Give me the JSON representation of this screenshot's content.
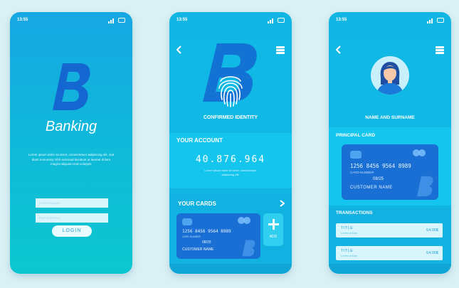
{
  "status": {
    "time": "13:55"
  },
  "login": {
    "brand": "Banking",
    "description": "Lorem ipsum dolor sit amet, consectetuer adipiscing elit, sed diam nonummy nibh euismod tincidunt ut laoreet dolore magna aliquam erat volutpat.",
    "username_placeholder": "USERNAME",
    "password_placeholder": "PASSWORD",
    "login_button": "LOGIN"
  },
  "account": {
    "confirmed_label": "CONFIRMED IDENTITY",
    "your_account_title": "YOUR ACCOUNT",
    "balance": "40.876.964",
    "description": "Lorem ipsum dolor sit amet, consectetuer adipiscing elit.",
    "your_cards_title": "YOUR CARDS",
    "card": {
      "number": "1256 8456 9564 8989",
      "number_label": "CARD NUMBER",
      "expiry": "08/25",
      "holder": "CUSTOMER NAME"
    },
    "add_label": "ADD"
  },
  "profile": {
    "name": "NAME AND SURNAME",
    "principal_card_title": "PRINCIPAL CARD",
    "card": {
      "number": "1256 8456 9564 8989",
      "number_label": "CARD NUMBER",
      "expiry": "08/25",
      "holder": "CUSTOMER NAME"
    },
    "transactions_title": "TRANSACTIONS",
    "transactions": [
      {
        "title": "TITLE",
        "subtitle": "Lorem ipsum",
        "amount": "54.00$"
      },
      {
        "title": "TITLE",
        "subtitle": "Lorem ipsum",
        "amount": "54.00$"
      }
    ]
  },
  "colors": {
    "background": "#d9f1f4",
    "screen_blue": "#12b6e4",
    "card_blue": "#1a6fd4",
    "logo_blue": "#1466d1"
  },
  "icons": [
    "signal-icon",
    "battery-icon",
    "back-arrow-icon",
    "menu-icon",
    "fingerprint-icon",
    "chevron-right-icon",
    "plus-icon",
    "avatar-icon"
  ]
}
